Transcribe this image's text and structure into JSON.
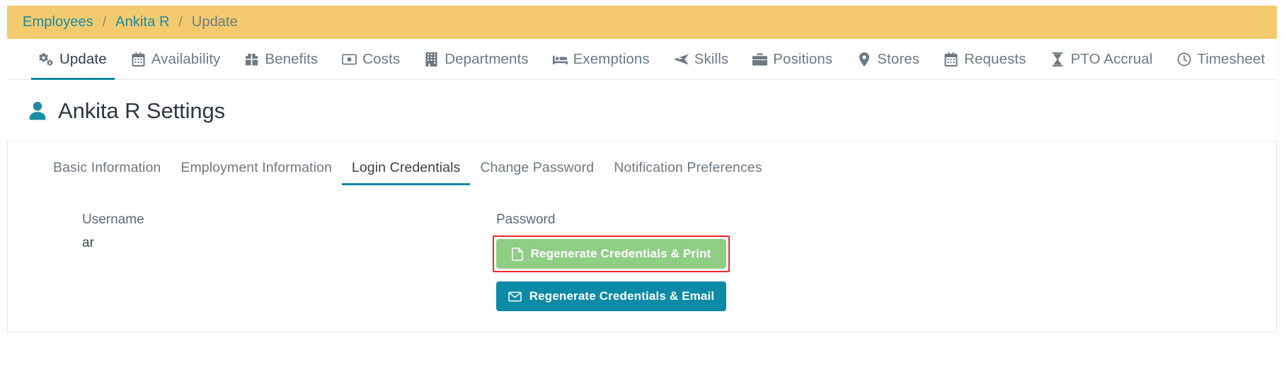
{
  "breadcrumb": {
    "items": [
      {
        "label": "Employees",
        "current": false
      },
      {
        "label": "Ankita R",
        "current": false
      },
      {
        "label": "Update",
        "current": true
      }
    ],
    "separator": "/"
  },
  "nav_tabs": [
    {
      "label": "Update",
      "icon": "gears-icon",
      "active": true
    },
    {
      "label": "Availability",
      "icon": "calendar-icon",
      "active": false
    },
    {
      "label": "Benefits",
      "icon": "gift-icon",
      "active": false
    },
    {
      "label": "Costs",
      "icon": "money-bill-icon",
      "active": false
    },
    {
      "label": "Departments",
      "icon": "building-icon",
      "active": false
    },
    {
      "label": "Exemptions",
      "icon": "bed-icon",
      "active": false
    },
    {
      "label": "Skills",
      "icon": "paper-plane-icon",
      "active": false
    },
    {
      "label": "Positions",
      "icon": "briefcase-icon",
      "active": false
    },
    {
      "label": "Stores",
      "icon": "map-marker-icon",
      "active": false
    },
    {
      "label": "Requests",
      "icon": "calendar-icon",
      "active": false
    },
    {
      "label": "PTO Accrual",
      "icon": "hourglass-icon",
      "active": false
    },
    {
      "label": "Timesheet",
      "icon": "clock-icon",
      "active": false
    }
  ],
  "page": {
    "title": "Ankita R Settings",
    "title_icon": "user-icon"
  },
  "sub_tabs": [
    {
      "label": "Basic Information",
      "active": false
    },
    {
      "label": "Employment Information",
      "active": false
    },
    {
      "label": "Login Credentials",
      "active": true
    },
    {
      "label": "Change Password",
      "active": false
    },
    {
      "label": "Notification Preferences",
      "active": false
    }
  ],
  "form": {
    "username_label": "Username",
    "username_value": "ar",
    "password_label": "Password",
    "regenerate_print_button": "Regenerate Credentials & Print",
    "regenerate_print_icon": "pdf-file-icon",
    "regenerate_email_button": "Regenerate Credentials & Email",
    "regenerate_email_icon": "envelope-icon"
  },
  "colors": {
    "breadcrumb_bg": "#f3cb6e",
    "link": "#1b8ca3",
    "accent": "#128ba0",
    "green_button": "#8fce85",
    "teal_button": "#0d8aa5",
    "highlight_border": "#ee2b2b"
  }
}
